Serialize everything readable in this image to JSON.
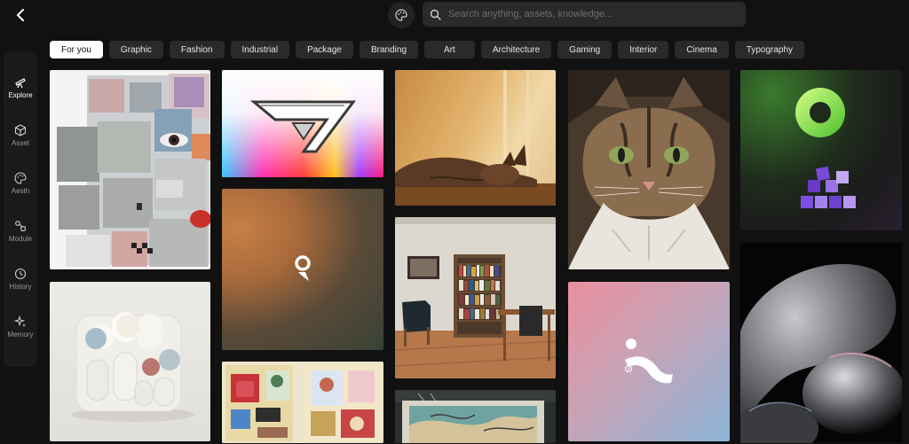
{
  "header": {
    "search_placeholder": "Search anything, assets, knowledge..."
  },
  "icons": {
    "back": "back-arrow-icon",
    "palette": "palette-icon",
    "search": "search-icon"
  },
  "categories": [
    "For you",
    "Graphic",
    "Fashion",
    "Industrial",
    "Package",
    "Branding",
    "Art",
    "Architecture",
    "Gaming",
    "Interior",
    "Cinema",
    "Typography"
  ],
  "active_category": "For you",
  "sidebar": {
    "items": [
      {
        "label": "Explore",
        "icon": "telescope-icon",
        "active": true
      },
      {
        "label": "Asset",
        "icon": "cube-icon",
        "active": false
      },
      {
        "label": "Aesth",
        "icon": "palette-icon",
        "active": false
      },
      {
        "label": "Module",
        "icon": "module-icon",
        "active": false
      },
      {
        "label": "History",
        "icon": "history-icon",
        "active": false
      },
      {
        "label": "Memory",
        "icon": "sparkle-icon",
        "active": false
      }
    ]
  },
  "colors": {
    "background": "#111111",
    "chip": "#2a2a2a",
    "chip_active": "#ffffff",
    "sidebar": "#1a1a1a"
  }
}
